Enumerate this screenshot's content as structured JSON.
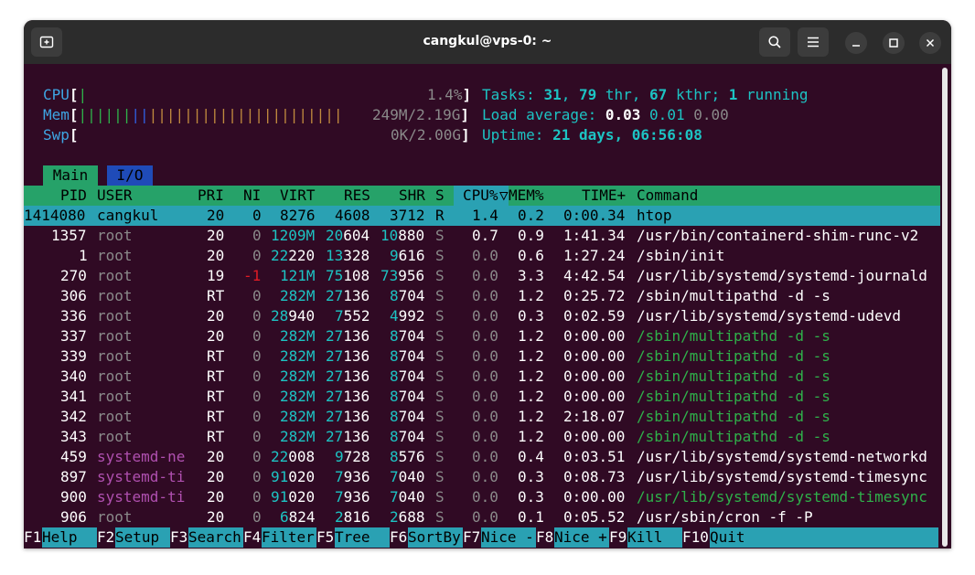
{
  "window": {
    "title": "cangkul@vps-0: ~"
  },
  "meters": {
    "cpu": {
      "label": "CPU",
      "bar": "|",
      "value": "1.4%"
    },
    "mem": {
      "label": "Mem",
      "bar_green": "||||||",
      "bar_blue": "||",
      "bar_orange": "||||||||||||||||||||||",
      "value": "249M/2.19G"
    },
    "swp": {
      "label": "Swp",
      "value": "0K/2.00G"
    },
    "tasks": {
      "label": "Tasks:",
      "count": "31",
      "thr": "79",
      "thr_label": "thr,",
      "kthr": "67",
      "kthr_label": "kthr;",
      "running": "1",
      "running_label": "running"
    },
    "load": {
      "label": "Load average:",
      "l1": "0.03",
      "l5": "0.01",
      "l15": "0.00"
    },
    "uptime": {
      "label": "Uptime:",
      "value": "21 days, 06:56:08"
    }
  },
  "tabs": [
    {
      "label": "Main"
    },
    {
      "label": "I/O"
    }
  ],
  "columns": [
    "PID",
    "USER",
    "PRI",
    "NI",
    "VIRT",
    "RES",
    "SHR",
    "S",
    "CPU%",
    "MEM%",
    "TIME+",
    "Command"
  ],
  "sort_indicator": "▽",
  "processes": [
    {
      "pid": "1414080",
      "user": "cangkul",
      "pri": "20",
      "ni": "0",
      "virt": "8276",
      "res": "4608",
      "shr": "3712",
      "s": "R",
      "cpu": "1.4",
      "mem": "0.2",
      "time": "0:00.34",
      "cmd": "htop"
    },
    {
      "pid": "1357",
      "user": "root",
      "pri": "20",
      "ni": "0",
      "virt": "1209M",
      "res": "20604",
      "shr": "10880",
      "s": "S",
      "cpu": "0.7",
      "mem": "0.9",
      "time": "1:41.34",
      "cmd": "/usr/bin/containerd-shim-runc-v2"
    },
    {
      "pid": "1",
      "user": "root",
      "pri": "20",
      "ni": "0",
      "virt": "22220",
      "res": "13328",
      "shr": "9616",
      "s": "S",
      "cpu": "0.0",
      "mem": "0.6",
      "time": "1:27.24",
      "cmd": "/sbin/init"
    },
    {
      "pid": "270",
      "user": "root",
      "pri": "19",
      "ni": "-1",
      "virt": "121M",
      "res": "75108",
      "shr": "73956",
      "s": "S",
      "cpu": "0.0",
      "mem": "3.3",
      "time": "4:42.54",
      "cmd": "/usr/lib/systemd/systemd-journald"
    },
    {
      "pid": "306",
      "user": "root",
      "pri": "RT",
      "ni": "0",
      "virt": "282M",
      "res": "27136",
      "shr": "8704",
      "s": "S",
      "cpu": "0.0",
      "mem": "1.2",
      "time": "0:25.72",
      "cmd": "/sbin/multipathd -d -s"
    },
    {
      "pid": "336",
      "user": "root",
      "pri": "20",
      "ni": "0",
      "virt": "28940",
      "res": "7552",
      "shr": "4992",
      "s": "S",
      "cpu": "0.0",
      "mem": "0.3",
      "time": "0:02.59",
      "cmd": "/usr/lib/systemd/systemd-udevd"
    },
    {
      "pid": "337",
      "user": "root",
      "pri": "20",
      "ni": "0",
      "virt": "282M",
      "res": "27136",
      "shr": "8704",
      "s": "S",
      "cpu": "0.0",
      "mem": "1.2",
      "time": "0:00.00",
      "cmd": "/sbin/multipathd -d -s"
    },
    {
      "pid": "339",
      "user": "root",
      "pri": "RT",
      "ni": "0",
      "virt": "282M",
      "res": "27136",
      "shr": "8704",
      "s": "S",
      "cpu": "0.0",
      "mem": "1.2",
      "time": "0:00.00",
      "cmd": "/sbin/multipathd -d -s"
    },
    {
      "pid": "340",
      "user": "root",
      "pri": "RT",
      "ni": "0",
      "virt": "282M",
      "res": "27136",
      "shr": "8704",
      "s": "S",
      "cpu": "0.0",
      "mem": "1.2",
      "time": "0:00.00",
      "cmd": "/sbin/multipathd -d -s"
    },
    {
      "pid": "341",
      "user": "root",
      "pri": "RT",
      "ni": "0",
      "virt": "282M",
      "res": "27136",
      "shr": "8704",
      "s": "S",
      "cpu": "0.0",
      "mem": "1.2",
      "time": "0:00.00",
      "cmd": "/sbin/multipathd -d -s"
    },
    {
      "pid": "342",
      "user": "root",
      "pri": "RT",
      "ni": "0",
      "virt": "282M",
      "res": "27136",
      "shr": "8704",
      "s": "S",
      "cpu": "0.0",
      "mem": "1.2",
      "time": "2:18.07",
      "cmd": "/sbin/multipathd -d -s"
    },
    {
      "pid": "343",
      "user": "root",
      "pri": "RT",
      "ni": "0",
      "virt": "282M",
      "res": "27136",
      "shr": "8704",
      "s": "S",
      "cpu": "0.0",
      "mem": "1.2",
      "time": "0:00.00",
      "cmd": "/sbin/multipathd -d -s"
    },
    {
      "pid": "459",
      "user": "systemd-ne",
      "pri": "20",
      "ni": "0",
      "virt": "22008",
      "res": "9728",
      "shr": "8576",
      "s": "S",
      "cpu": "0.0",
      "mem": "0.4",
      "time": "0:03.51",
      "cmd": "/usr/lib/systemd/systemd-networkd"
    },
    {
      "pid": "897",
      "user": "systemd-ti",
      "pri": "20",
      "ni": "0",
      "virt": "91020",
      "res": "7936",
      "shr": "7040",
      "s": "S",
      "cpu": "0.0",
      "mem": "0.3",
      "time": "0:08.73",
      "cmd": "/usr/lib/systemd/systemd-timesync"
    },
    {
      "pid": "900",
      "user": "systemd-ti",
      "pri": "20",
      "ni": "0",
      "virt": "91020",
      "res": "7936",
      "shr": "7040",
      "s": "S",
      "cpu": "0.0",
      "mem": "0.3",
      "time": "0:00.00",
      "cmd": "/usr/lib/systemd/systemd-timesync"
    },
    {
      "pid": "906",
      "user": "root",
      "pri": "20",
      "ni": "0",
      "virt": "6824",
      "res": "2816",
      "shr": "2688",
      "s": "S",
      "cpu": "0.0",
      "mem": "0.1",
      "time": "0:05.52",
      "cmd": "/usr/sbin/cron -f -P"
    }
  ],
  "function_keys": [
    {
      "key": "F1",
      "label": "Help"
    },
    {
      "key": "F2",
      "label": "Setup"
    },
    {
      "key": "F3",
      "label": "Search"
    },
    {
      "key": "F4",
      "label": "Filter"
    },
    {
      "key": "F5",
      "label": "Tree"
    },
    {
      "key": "F6",
      "label": "SortBy"
    },
    {
      "key": "F7",
      "label": "Nice -"
    },
    {
      "key": "F8",
      "label": "Nice +"
    },
    {
      "key": "F9",
      "label": "Kill"
    },
    {
      "key": "F10",
      "label": "Quit"
    }
  ]
}
